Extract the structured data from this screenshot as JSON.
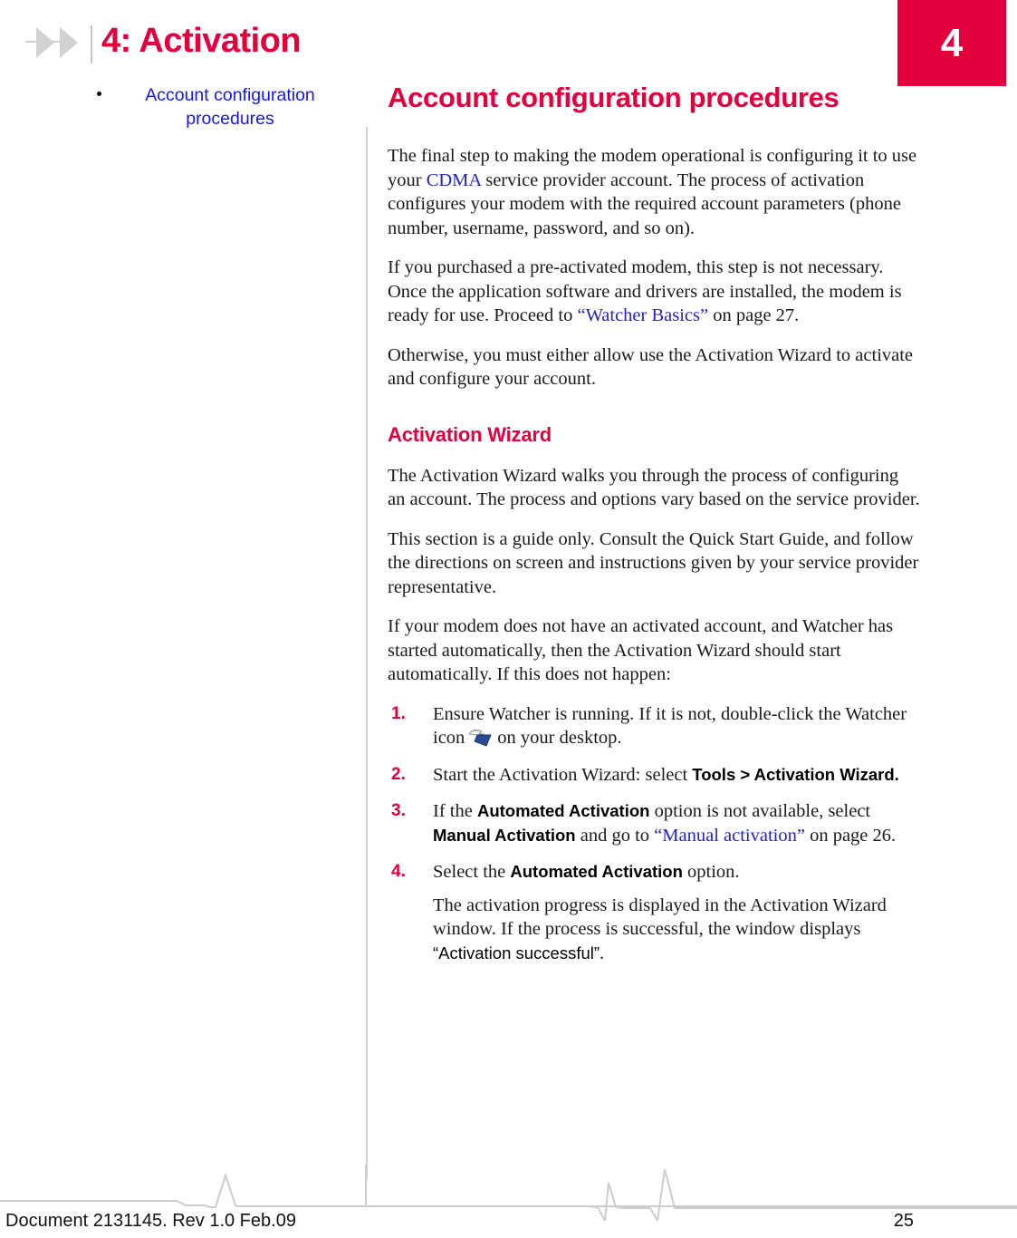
{
  "chapter": {
    "tab_number": "4",
    "running_head": "4: Activation",
    "accent_color": "#e4003c"
  },
  "sidebar": {
    "items": [
      {
        "label": "Account configuration procedures"
      }
    ]
  },
  "main": {
    "heading": "Account configuration procedures",
    "intro_paragraphs": [
      {
        "part1": "The final step to making the modem operational is configuring it to use your ",
        "link1": "CDMA",
        "part2": " service provider account. The process of activation configures your modem with the required account parameters (phone number, username, password, and so on)."
      },
      {
        "part1": "If you purchased a pre-activated modem, this step is not necessary. Once the application software and drivers are installed, the modem is ready for use. Proceed to ",
        "link1": "“Watcher Basics”",
        "part2": " on page 27."
      },
      {
        "part1": "Otherwise, you must either allow use the Activation Wizard to activate and configure your account.",
        "link1": "",
        "part2": ""
      }
    ],
    "section": {
      "heading": "Activation Wizard",
      "paragraphs": [
        "The Activation Wizard walks you through the process of configuring an account. The process and options vary based on the service provider.",
        "This section is a guide only. Consult the Quick Start Guide, and follow the directions on screen and instructions given by your service provider representative.",
        "If your modem does not have an activated account, and Watcher has started automatically, then the Activation Wizard should start automatically. If this does not happen:"
      ],
      "steps": [
        {
          "number": "1.",
          "text_before": "Ensure Watcher is running. If it is not, double-click the Watcher icon",
          "icon": "watcher-icon",
          "text_after": "on your desktop."
        },
        {
          "number": "2.",
          "text_before": "Start the Activation Wizard: select ",
          "ui_term": "Tools > Activation Wizard.",
          "text_after": ""
        },
        {
          "number": "3.",
          "text_before": "If the ",
          "ui_term": "Automated Activation",
          "text_mid": " option is not available, select ",
          "ui_term2": "Manual Activation",
          "text_mid2": " and go to ",
          "link": "“Manual activation”",
          "text_after": " on page 26."
        },
        {
          "number": "4.",
          "text_before": "Select the ",
          "ui_term": "Automated Activation",
          "text_after": " option.",
          "note_before": "The activation progress is displayed in the Activation Wizard window. If the process is successful, the window displays ",
          "note_ui": "“Activation successful”",
          "note_after": "."
        }
      ]
    }
  },
  "footer": {
    "document_info": "Document 2131145. Rev 1.0  Feb.09",
    "page_number": "25"
  }
}
